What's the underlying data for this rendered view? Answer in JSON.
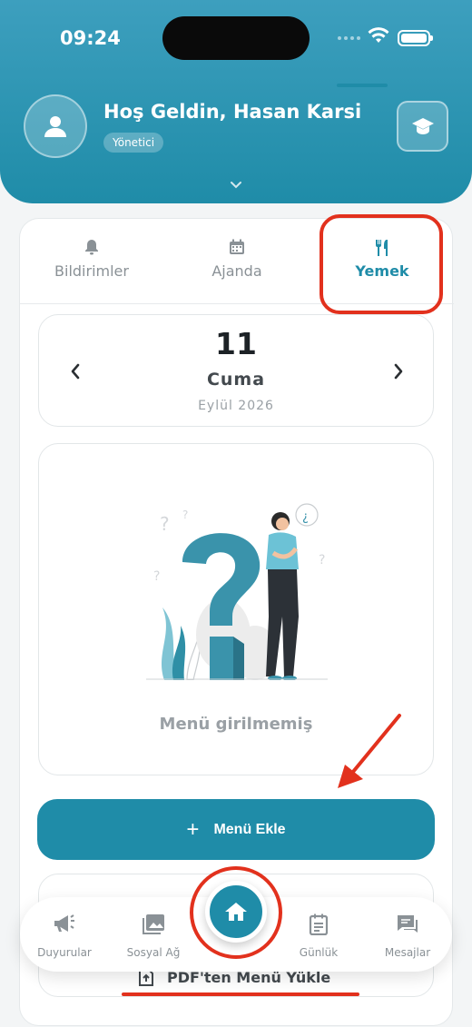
{
  "status_bar": {
    "time": "09:24"
  },
  "header": {
    "greeting": "Hoş Geldin, Hasan Karsi",
    "role": "Yönetici"
  },
  "tabs": [
    {
      "label": "Bildirimler",
      "icon": "bell-icon",
      "active": false
    },
    {
      "label": "Ajanda",
      "icon": "calendar-icon",
      "active": false
    },
    {
      "label": "Yemek",
      "icon": "utensils-icon",
      "active": true
    }
  ],
  "date": {
    "day": "11",
    "weekday": "Cuma",
    "month_year": "Eylül 2026"
  },
  "empty_state": {
    "text": "Menü girilmemiş"
  },
  "actions": {
    "add_menu": "Menü Ekle",
    "pdf_upload": "PDF'ten Menü Yükle"
  },
  "bottom_nav": [
    {
      "label": "Duyurular",
      "icon": "megaphone-icon"
    },
    {
      "label": "Sosyal Ağ",
      "icon": "photos-icon"
    },
    {
      "label": "",
      "icon": "home-icon"
    },
    {
      "label": "Günlük",
      "icon": "journal-icon"
    },
    {
      "label": "Mesajlar",
      "icon": "chat-icon"
    }
  ],
  "colors": {
    "primary": "#1f8ca8",
    "annotation_red": "#e2311d"
  }
}
